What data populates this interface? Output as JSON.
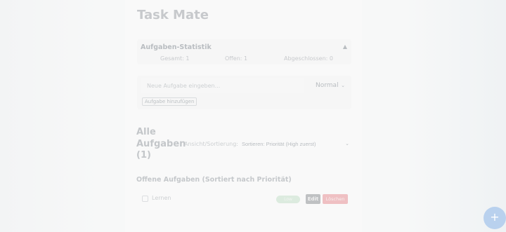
{
  "app": {
    "title": "Task Mate"
  },
  "stats": {
    "title": "Aufgaben-Statistik",
    "toggle_icon": "▲",
    "total": "Gesamt: 1",
    "open": "Offen: 1",
    "done": "Abgeschlossen: 0"
  },
  "add_task": {
    "placeholder": "Neue Aufgabe eingeben...",
    "priority_value": "Normal",
    "button_label": "Aufgabe hinzufügen"
  },
  "list": {
    "heading": "Alle Aufgaben (1)",
    "view_label": "Ansicht/Sortierung:",
    "sort_value": "Sortieren: Priorität (High zuerst)"
  },
  "section": {
    "heading": "Offene Aufgaben (Sortiert nach Priorität)"
  },
  "tasks": [
    {
      "text": "Lernen",
      "priority": "Low",
      "edit_label": "Edit",
      "delete_label": "Löschen"
    }
  ],
  "fab": {
    "label": "+"
  },
  "colors": {
    "accent": "#b9d1ee",
    "danger": "#efc0c3",
    "low_priority": "#dcebdf"
  }
}
